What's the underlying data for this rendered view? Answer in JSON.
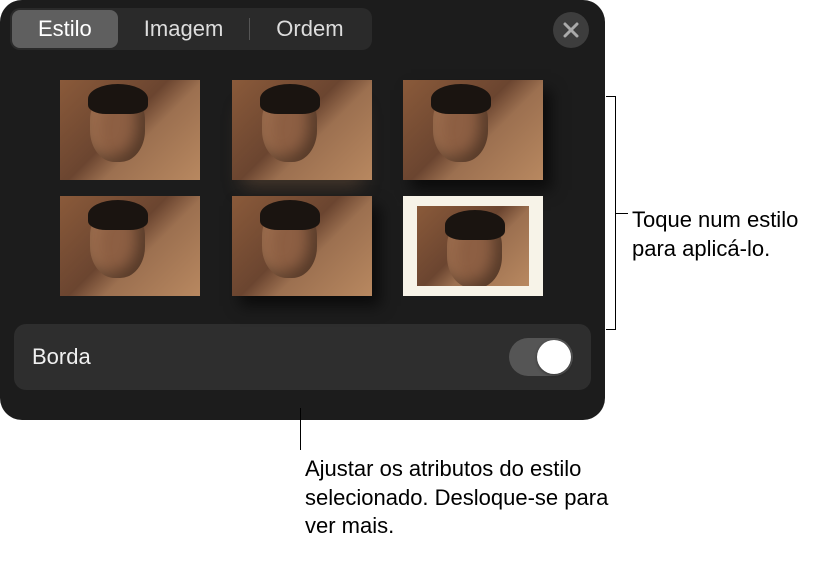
{
  "tabs": {
    "style": "Estilo",
    "image": "Imagem",
    "order": "Ordem"
  },
  "active_tab": "style",
  "border": {
    "label": "Borda",
    "enabled": false
  },
  "callouts": {
    "right": "Toque num estilo para aplicá-lo.",
    "bottom": "Ajustar os atributos do estilo selecionado. Desloque-se para ver mais."
  },
  "style_variants": [
    {
      "id": "plain"
    },
    {
      "id": "reflection"
    },
    {
      "id": "shadow"
    },
    {
      "id": "plain2"
    },
    {
      "id": "shadow2"
    },
    {
      "id": "frame"
    }
  ]
}
